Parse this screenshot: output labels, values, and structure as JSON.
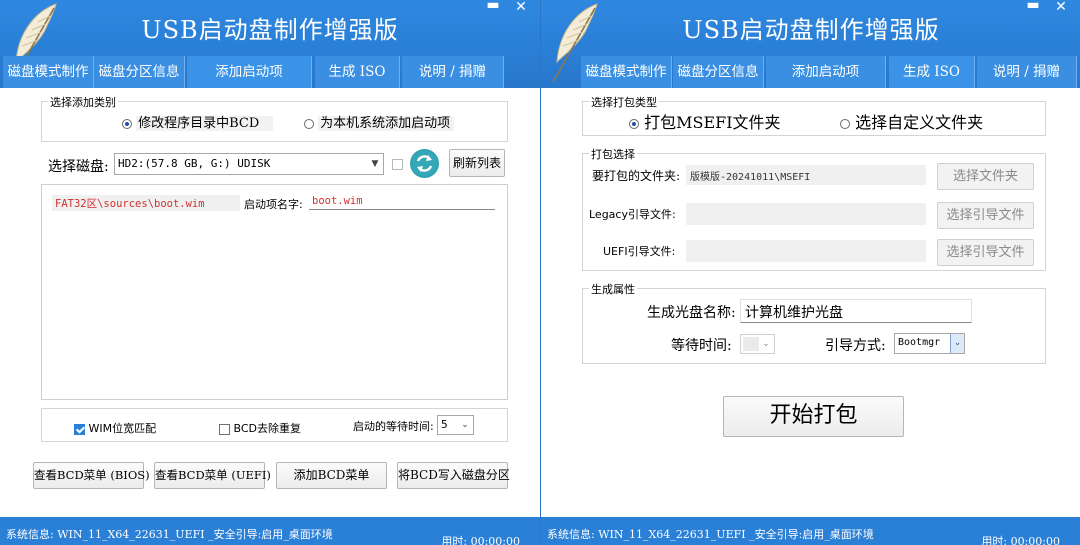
{
  "app": {
    "title": "USB启动盘制作增强版",
    "min_glyph": "▬",
    "close_glyph": "✕",
    "accent": "#2a7fd6"
  },
  "tabs": [
    "磁盘模式制作",
    "磁盘分区信息",
    "添加启动项",
    "生成 ISO",
    "说明 / 捐赠"
  ],
  "left": {
    "add_type": {
      "label": "选择添加类别",
      "option_modify": "修改程序目录中BCD",
      "option_add_local": "为本机系统添加启动项",
      "selected": "option_modify"
    },
    "disk": {
      "label": "选择磁盘:",
      "value": "HD2:(57.8 GB, G:)  UDISK",
      "refresh_list": "刷新列表"
    },
    "entry": {
      "path": "FAT32区\\sources\\boot.wim",
      "name_label": "启动项名字:",
      "name_value": "boot.wim"
    },
    "options": {
      "wim_match": "WIM位宽匹配",
      "wim_match_checked": true,
      "bcd_dedup": "BCD去除重复",
      "bcd_dedup_checked": false,
      "wait_label": "启动的等待时间:",
      "wait_value": "5"
    },
    "buttons": {
      "view_bios": "查看BCD菜单 (BIOS)",
      "view_uefi": "查看BCD菜单 (UEFI)",
      "add_menu": "添加BCD菜单",
      "write_partition": "将BCD写入磁盘分区"
    }
  },
  "right": {
    "pack_type": {
      "label": "选择打包类型",
      "option_msefi": "打包MSEFI文件夹",
      "option_custom": "选择自定义文件夹",
      "selected": "option_msefi"
    },
    "pack_select": {
      "label": "打包选择",
      "folder_label": "要打包的文件夹:",
      "folder_value": "版模版-20241011\\MSEFI",
      "choose_folder": "选择文件夹",
      "legacy_label": "Legacy引导文件:",
      "legacy_value": "",
      "choose_boot_1": "选择引导文件",
      "uefi_label": "UEFI引导文件:",
      "uefi_value": "",
      "choose_boot_2": "选择引导文件"
    },
    "gen_props": {
      "label": "生成属性",
      "disc_name_label": "生成光盘名称:",
      "disc_name_value": "计算机维护光盘",
      "wait_label": "等待时间:",
      "wait_value": "",
      "boot_mode_label": "引导方式:",
      "boot_mode_value": "Bootmgr"
    },
    "start_pack": "开始打包"
  },
  "status": {
    "system_info": "系统信息:  WIN_11_X64_22631_UEFI _安全引导:启用_桌面环境",
    "time": "用时: 00:00:00"
  }
}
